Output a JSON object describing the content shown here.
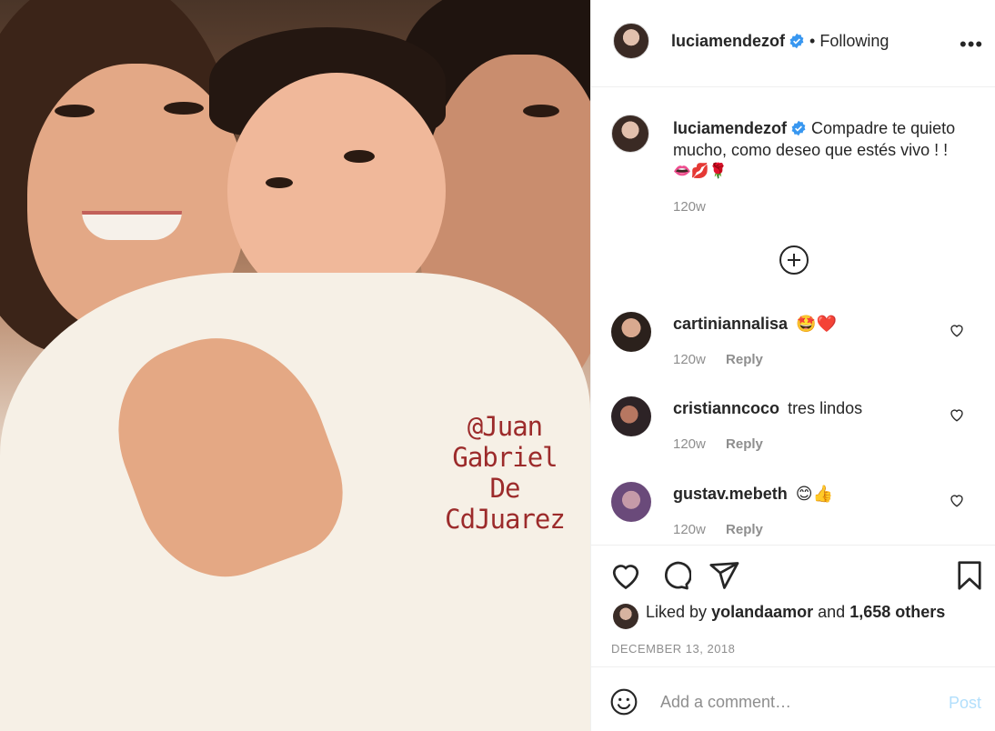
{
  "photo": {
    "watermark_lines": [
      "@Juan Gabriel",
      "De",
      "CdJuarez"
    ]
  },
  "header": {
    "username": "luciamendezof",
    "separator": "•",
    "follow_status": "Following",
    "more_label": "•••"
  },
  "caption": {
    "username": "luciamendezof",
    "text": "Compadre te quieto mucho, como deseo que estés vivo ! !",
    "emojis": "👄💋🌹",
    "time": "120w"
  },
  "comments": [
    {
      "username": "cartiniannalisa",
      "text": "🤩❤️",
      "time": "120w",
      "reply_label": "Reply"
    },
    {
      "username": "cristianncoco",
      "text": "tres lindos",
      "time": "120w",
      "reply_label": "Reply"
    },
    {
      "username": "gustav.mebeth",
      "text": "😊👍",
      "time": "120w",
      "reply_label": "Reply"
    }
  ],
  "likes": {
    "prefix": "Liked by",
    "user": "yolandaamor",
    "middle": "and",
    "others": "1,658 others"
  },
  "date": "DECEMBER 13, 2018",
  "add_comment": {
    "placeholder": "Add a comment…",
    "post_label": "Post"
  },
  "colors": {
    "verified": "#3897f0",
    "text": "#262626",
    "muted": "#8e8e8e",
    "post_disabled": "#b2dffc",
    "divider": "#efefef"
  },
  "icons": [
    "verified-icon",
    "more-options-icon",
    "load-more-icon",
    "heart-icon",
    "comment-icon",
    "share-icon",
    "bookmark-icon",
    "emoji-icon"
  ]
}
